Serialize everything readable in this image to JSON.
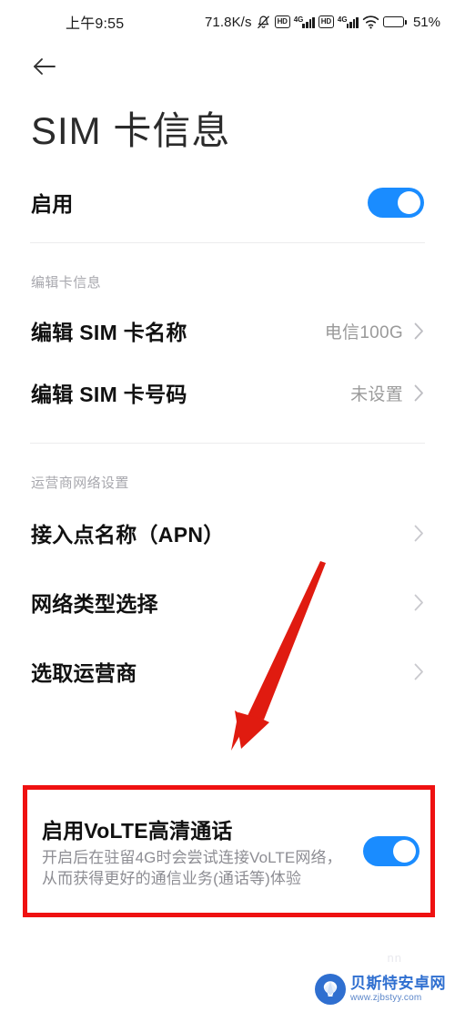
{
  "statusbar": {
    "time": "上午9:55",
    "net_speed": "71.8K/s",
    "mute_icon": "mute-bell-icon",
    "hd_badge_1": "HD",
    "net_4g_1": "4G",
    "hd_badge_2": "HD",
    "net_4g_2": "4G",
    "wifi_icon": "wifi-icon",
    "battery_percent": "51%",
    "battery_level": 51
  },
  "nav": {
    "back_icon": "back-arrow-icon",
    "back_label": "返回"
  },
  "header": {
    "title": "SIM 卡信息"
  },
  "enable_row": {
    "label": "启用",
    "toggle_state": "on"
  },
  "sections": [
    {
      "label": "编辑卡信息",
      "items": [
        {
          "title": "编辑 SIM 卡名称",
          "value": "电信100G",
          "chevron": "chevron-right-icon"
        },
        {
          "title": "编辑 SIM 卡号码",
          "value": "未设置",
          "chevron": "chevron-right-icon"
        }
      ]
    },
    {
      "label": "运营商网络设置",
      "items": [
        {
          "title": "接入点名称（APN）",
          "value": "",
          "chevron": "chevron-right-icon"
        },
        {
          "title": "网络类型选择",
          "value": "",
          "chevron": "chevron-right-icon"
        },
        {
          "title": "选取运营商",
          "value": "",
          "chevron": "chevron-right-icon"
        }
      ]
    }
  ],
  "volte": {
    "title": "启用VoLTE高清通话",
    "description": "开启后在驻留4G时会尝试连接VoLTE网络，从而获得更好的通信业务(通话等)体验",
    "toggle_state": "on",
    "highlight_color": "#ef1111"
  },
  "annotation": {
    "arrow_color": "#e01b10",
    "arrow_name": "red-pointer-arrow"
  },
  "watermark": {
    "site_name": "贝斯特安卓网",
    "url": "www.zjbstyy.com",
    "ghost_text": "nn"
  },
  "colors": {
    "accent_blue": "#1a8cff",
    "highlight_red": "#ef1111",
    "muted_text": "#9a9a9a",
    "section_label": "#a8a8ae"
  }
}
